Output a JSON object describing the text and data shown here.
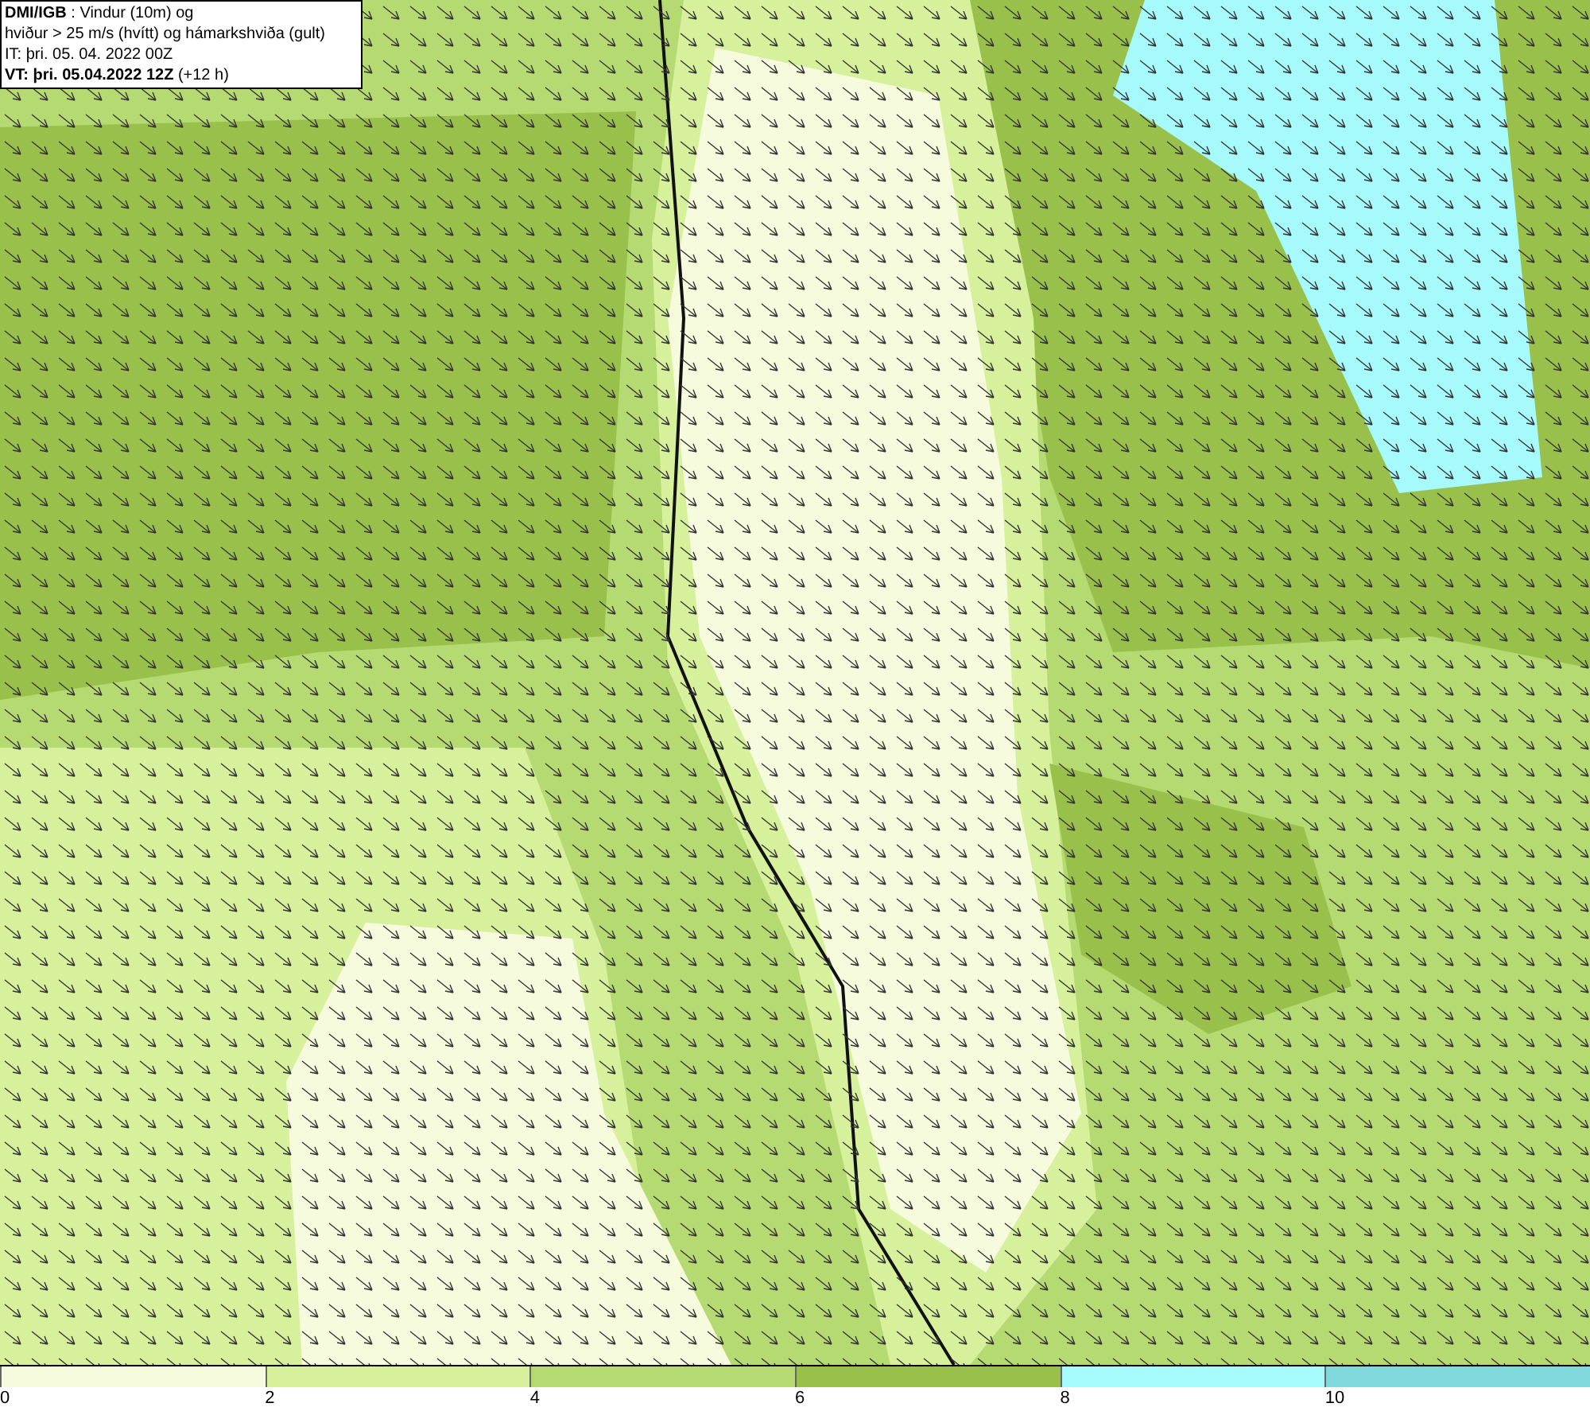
{
  "title_box": {
    "lines": [
      "**DMI/IGB** : Vindur (10m) og",
      "hviður > 25 m/s (hvítt) og hámarkshviða (gult)",
      "IT: þri. 05. 04. 2022 00Z",
      "**VT: þri. 05.04.2022 12Z** (+12 h)"
    ]
  },
  "legend": [
    {
      "label": "0",
      "color": "#f5fbdc"
    },
    {
      "label": "2",
      "color": "#d6f09c"
    },
    {
      "label": "4",
      "color": "#b6da72"
    },
    {
      "label": "6",
      "color": "#98c04a"
    },
    {
      "label": "8",
      "color": "#a6fafc"
    },
    {
      "label": "10",
      "color": "#80d8da"
    }
  ]
}
